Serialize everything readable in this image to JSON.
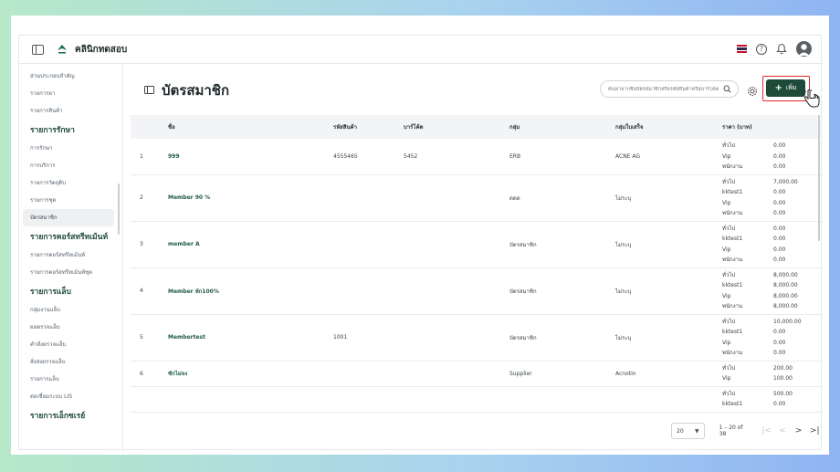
{
  "topbar": {
    "clinic_name": "คลินิกทดสอบ",
    "icons": [
      "sidebar-toggle-icon",
      "clinic-logo",
      "thai-flag-icon",
      "help-icon",
      "bell-icon",
      "avatar"
    ]
  },
  "sidebar": {
    "top_items": [
      "ส่วนประกอบสำคัญ",
      "รายการยา",
      "รายการสินค้า"
    ],
    "sections": [
      {
        "heading": "รายการรักษา",
        "items": [
          "การรักษา",
          "การบริการ",
          "รายการวัตถุดิบ",
          "รายการชุด",
          "บัตรสมาชิก"
        ]
      },
      {
        "heading": "รายการคอร์สทรีทเม้นท์",
        "items": [
          "รายการคอร์สทรีทเม้นท์",
          "รายการคอร์สทรีทเม้นท์ชุด"
        ]
      },
      {
        "heading": "รายการแล็บ",
        "items": [
          "กลุ่มงานแล็บ",
          "ผลตรวจแล็บ",
          "คำสั่งตรวจแล็บ",
          "สั่งส่งตรวจแล็บ",
          "รายการแล็บ",
          "ต่อเชื่อมระบบ LIS"
        ]
      },
      {
        "heading": "รายการเอ็กซเรย์",
        "items": []
      }
    ],
    "active_item": "บัตรสมาชิก"
  },
  "main": {
    "title": "บัตรสมาชิก",
    "search_placeholder": "ค้นหาจากชื่อบัตรสมาชิกหรือรหัสสินค้าหรือบาร์โค้ด",
    "add_button_label": "เพิ่ม",
    "columns": [
      "ชื่อ",
      "รหัสสินค้า",
      "บาร์โค้ด",
      "กลุ่ม",
      "กลุ่มใบเสร็จ",
      "ราคา (บาท)"
    ],
    "rows": [
      {
        "idx": "1",
        "name": "999",
        "sku": "4555465",
        "barcode": "5452",
        "group": "ERB",
        "receipt_group": "ACNE AG",
        "prices": [
          [
            "ทั่วไป",
            "0.00"
          ],
          [
            "Vip",
            "0.00"
          ],
          [
            "พนักงาน",
            "0.00"
          ]
        ]
      },
      {
        "idx": "2",
        "name": "Member 90 %",
        "sku": "",
        "barcode": "",
        "group": "ดดด",
        "receipt_group": "ไม่ระบุ",
        "prices": [
          [
            "ทั่วไป",
            "7,000.00"
          ],
          [
            "kktest1",
            "0.00"
          ],
          [
            "Vip",
            "0.00"
          ],
          [
            "พนักงาน",
            "0.00"
          ]
        ]
      },
      {
        "idx": "3",
        "name": "member A",
        "sku": "",
        "barcode": "",
        "group": "บัตรสมาชิก",
        "receipt_group": "ไม่ระบุ",
        "prices": [
          [
            "ทั่วไป",
            "0.00"
          ],
          [
            "kktest1",
            "0.00"
          ],
          [
            "Vip",
            "0.00"
          ],
          [
            "พนักงาน",
            "0.00"
          ]
        ]
      },
      {
        "idx": "4",
        "name": "Member หัก100%",
        "sku": "",
        "barcode": "",
        "group": "บัตรสมาชิก",
        "receipt_group": "ไม่ระบุ",
        "prices": [
          [
            "ทั่วไป",
            "8,000.00"
          ],
          [
            "kktest1",
            "8,000.00"
          ],
          [
            "Vip",
            "8,000.00"
          ],
          [
            "พนักงาน",
            "8,000.00"
          ]
        ]
      },
      {
        "idx": "5",
        "name": "Membertest",
        "sku": "1001",
        "barcode": "",
        "group": "บัตรสมาชิก",
        "receipt_group": "ไม่ระบุ",
        "prices": [
          [
            "ทั่วไป",
            "10,000.00"
          ],
          [
            "kktest1",
            "0.00"
          ],
          [
            "Vip",
            "0.00"
          ],
          [
            "พนักงาน",
            "0.00"
          ]
        ]
      },
      {
        "idx": "6",
        "name": "ซักไม่จง",
        "sku": "",
        "barcode": "",
        "group": "Supplier",
        "receipt_group": "Acnotin",
        "prices": [
          [
            "ทั่วไป",
            "200.00"
          ],
          [
            "Vip",
            "100.00"
          ]
        ]
      },
      {
        "idx": "",
        "name": "",
        "sku": "",
        "barcode": "",
        "group": "",
        "receipt_group": "",
        "prices": [
          [
            "ทั่วไป",
            "500.00"
          ],
          [
            "kktest1",
            "0.00"
          ]
        ]
      }
    ]
  },
  "pagination": {
    "rows_per_page": "20",
    "range_text": "1 – 20 of 38"
  },
  "colors": {
    "accent": "#1e4a3a",
    "highlight_box": "#e0262b"
  }
}
